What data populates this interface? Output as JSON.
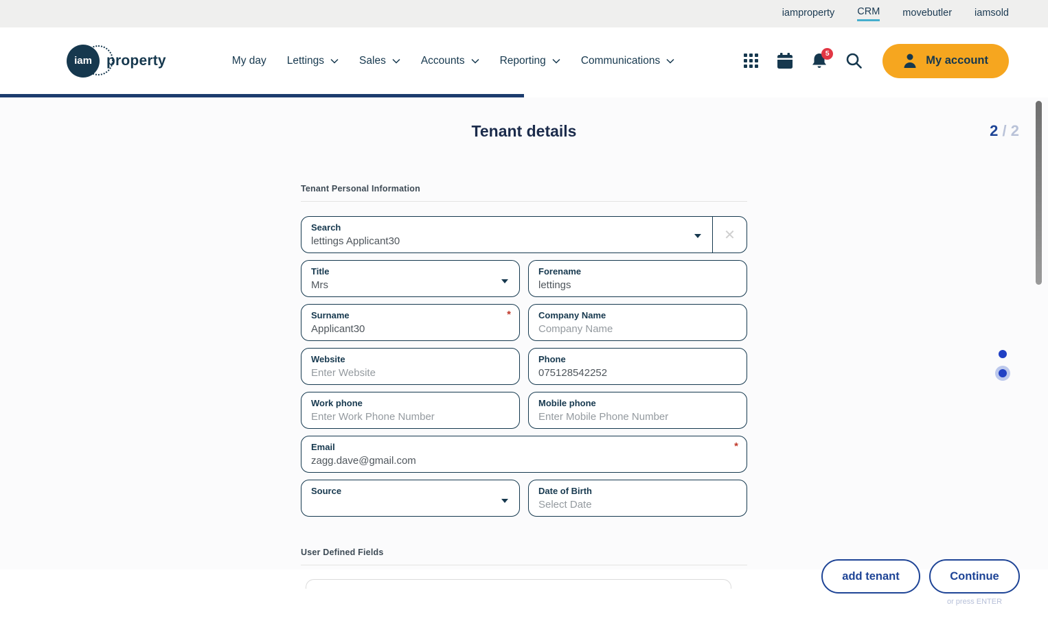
{
  "top_bar": {
    "links": [
      {
        "label": "iamproperty",
        "active": false
      },
      {
        "label": "CRM",
        "active": true
      },
      {
        "label": "movebutler",
        "active": false
      },
      {
        "label": "iamsold",
        "active": false
      }
    ]
  },
  "header": {
    "logo": {
      "circle_text": "iam",
      "brand_text": "property"
    },
    "nav": [
      {
        "label": "My day"
      },
      {
        "label": "Lettings"
      },
      {
        "label": "Sales"
      },
      {
        "label": "Accounts"
      },
      {
        "label": "Reporting"
      },
      {
        "label": "Communications"
      }
    ],
    "notification_count": "5",
    "account_button_label": "My account",
    "icons": [
      "apps-grid-icon",
      "calendar-icon",
      "bell-icon",
      "search-icon",
      "user-icon"
    ]
  },
  "page": {
    "title": "Tenant details",
    "step_current": "2",
    "step_separator": "/",
    "step_total": "2"
  },
  "form": {
    "section1_title": "Tenant Personal Information",
    "section2_title": "User Defined Fields",
    "required_marker": "*",
    "clear_icon": "✕",
    "search": {
      "label": "Search",
      "value": "lettings Applicant30"
    },
    "fields": {
      "title": {
        "label": "Title",
        "value": "Mrs"
      },
      "forename": {
        "label": "Forename",
        "value": "lettings"
      },
      "surname": {
        "label": "Surname",
        "value": "Applicant30"
      },
      "company": {
        "label": "Company Name",
        "placeholder": "Company Name"
      },
      "website": {
        "label": "Website",
        "placeholder": "Enter Website"
      },
      "phone": {
        "label": "Phone",
        "value": "075128542252"
      },
      "work_phone": {
        "label": "Work phone",
        "placeholder": "Enter Work Phone Number"
      },
      "mobile_phone": {
        "label": "Mobile phone",
        "placeholder": "Enter Mobile Phone Number"
      },
      "email": {
        "label": "Email",
        "value": "zagg.dave@gmail.com"
      },
      "source": {
        "label": "Source",
        "value": ""
      },
      "dob": {
        "label": "Date of Birth",
        "placeholder": "Select Date"
      }
    }
  },
  "footer": {
    "add_tenant_label": "add tenant",
    "continue_label": "Continue",
    "enter_hint": "or press ENTER"
  },
  "colors": {
    "accent_orange": "#F6A61F",
    "navy": "#16384E",
    "royal_blue": "#1E4496",
    "teal_underline": "#45AECD",
    "badge_red": "#E23744",
    "required_red": "#C0392B",
    "progress_navy": "#1C3C6E",
    "dot_blue": "#2040C4"
  }
}
